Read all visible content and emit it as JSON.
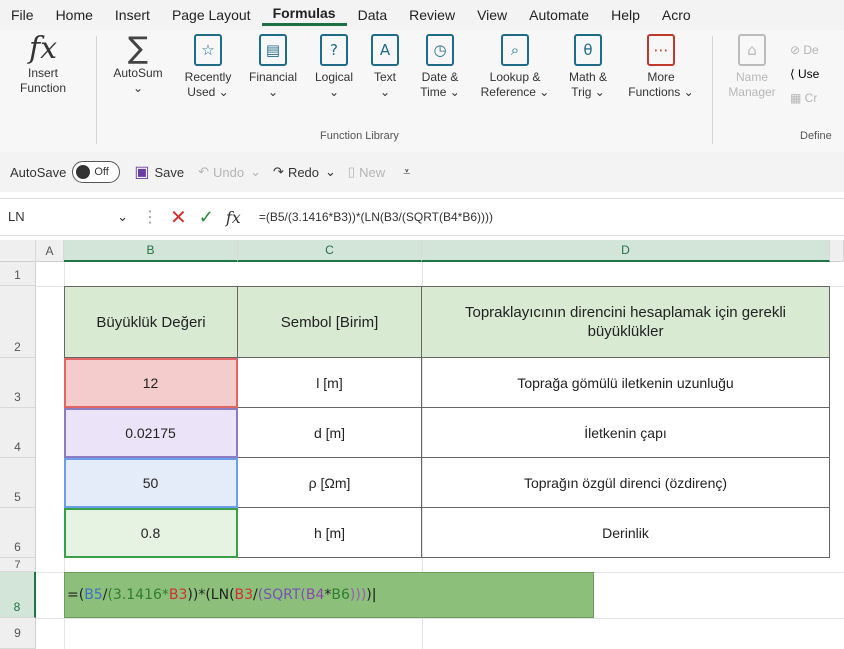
{
  "menu": {
    "items": [
      "File",
      "Home",
      "Insert",
      "Page Layout",
      "Formulas",
      "Data",
      "Review",
      "View",
      "Automate",
      "Help",
      "Acro"
    ],
    "active": "Formulas"
  },
  "ribbon": {
    "insert_function": {
      "line1": "Insert",
      "line2": "Function"
    },
    "autosum": {
      "line1": "AutoSum",
      "line2": "⌄"
    },
    "recently_used": {
      "line1": "Recently",
      "line2": "Used ⌄"
    },
    "financial": {
      "line1": "Financial",
      "line2": "⌄"
    },
    "logical": {
      "line1": "Logical",
      "line2": "⌄"
    },
    "text": {
      "line1": "Text",
      "line2": "⌄"
    },
    "date_time": {
      "line1": "Date &",
      "line2": "Time ⌄"
    },
    "lookup_reference": {
      "line1": "Lookup &",
      "line2": "Reference ⌄"
    },
    "math_trig": {
      "line1": "Math &",
      "line2": "Trig ⌄"
    },
    "more_functions": {
      "line1": "More",
      "line2": "Functions ⌄"
    },
    "name_manager": {
      "line1": "Name",
      "line2": "Manager"
    },
    "define_items": [
      "De",
      "Use",
      "Cr"
    ],
    "group_function_library": "Function Library",
    "group_defined": "Define"
  },
  "qat": {
    "autosave": "AutoSave",
    "toggle_state": "Off",
    "save": "Save",
    "undo": "Undo",
    "redo": "Redo",
    "new": "New"
  },
  "formula_bar": {
    "name_box": "LN",
    "formula": "=(B5/(3.1416*B3))*(LN(B3/(SQRT(B4*B6))))"
  },
  "columns": [
    "A",
    "B",
    "C",
    "D"
  ],
  "rows": [
    "1",
    "2",
    "3",
    "4",
    "5",
    "6",
    "7",
    "8",
    "9"
  ],
  "table": {
    "headers": [
      "Büyüklük Değeri",
      "Sembol [Birim]",
      "Topraklayıcının direncini hesaplamak için gerekli büyüklükler"
    ],
    "rows": [
      {
        "value": "12",
        "symbol": "l [m]",
        "desc": "Toprağa gömülü iletkenin uzunluğu",
        "color": "#f4cccc"
      },
      {
        "value": "0.02175",
        "symbol": "d [m]",
        "desc": "İletkenin çapı",
        "color": "#ebe3f7"
      },
      {
        "value": "50",
        "symbol": "ρ [Ωm]",
        "desc": "Toprağın özgül direnci (özdirenç)",
        "color": "#e3ecf8"
      },
      {
        "value": "0.8",
        "symbol": "h [m]",
        "desc": "Derinlik",
        "color": "#e6f3e3"
      }
    ],
    "border_colors": [
      "#e06666",
      "#8e7cc3",
      "#6d9eeb",
      "#38a04a"
    ]
  },
  "edit_cell": {
    "parts": [
      {
        "t": "=(",
        "c": "#222222"
      },
      {
        "t": "B5",
        "c": "#3c6fc9"
      },
      {
        "t": "/",
        "c": "#222222"
      },
      {
        "t": "(3.1416*",
        "c": "#2f7d2f"
      },
      {
        "t": "B3",
        "c": "#d0302f"
      },
      {
        "t": "))*(LN(",
        "c": "#222222"
      },
      {
        "t": "B3",
        "c": "#d0302f"
      },
      {
        "t": "/",
        "c": "#222222"
      },
      {
        "t": "(SQRT(",
        "c": "#7b4fb5"
      },
      {
        "t": "B4",
        "c": "#8e44ad"
      },
      {
        "t": "*",
        "c": "#222222"
      },
      {
        "t": "B6",
        "c": "#2f7d2f"
      },
      {
        "t": ")))",
        "c": "#9b59b6"
      },
      {
        "t": ")",
        "c": "#222222"
      }
    ]
  }
}
